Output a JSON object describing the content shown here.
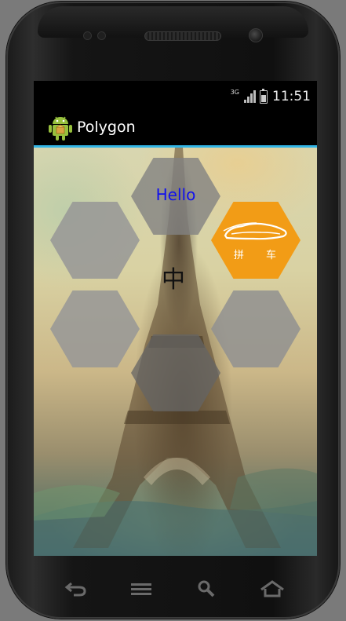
{
  "status_bar": {
    "network_type": "3G",
    "time": "11:51"
  },
  "action_bar": {
    "app_icon": "android-robot-icon",
    "title": "Polygon"
  },
  "content": {
    "background_image": "eiffel-tower-painting",
    "hexagons": [
      {
        "name": "top",
        "label": "Hello",
        "label_color": "#1010ee"
      },
      {
        "name": "upper-left",
        "label": ""
      },
      {
        "name": "upper-right",
        "icon": "car-icon",
        "label": "拼 车",
        "fill": "#f29c16"
      },
      {
        "name": "lower-left",
        "label": ""
      },
      {
        "name": "lower-right",
        "label": ""
      },
      {
        "name": "bottom",
        "label": ""
      }
    ],
    "center_label": "中"
  },
  "nav_buttons": [
    {
      "name": "back",
      "icon": "back-arrow-icon"
    },
    {
      "name": "menu",
      "icon": "menu-icon"
    },
    {
      "name": "search",
      "icon": "search-icon"
    },
    {
      "name": "home",
      "icon": "home-icon"
    }
  ],
  "colors": {
    "accent": "#33b5e5",
    "orange": "#f29c16"
  }
}
